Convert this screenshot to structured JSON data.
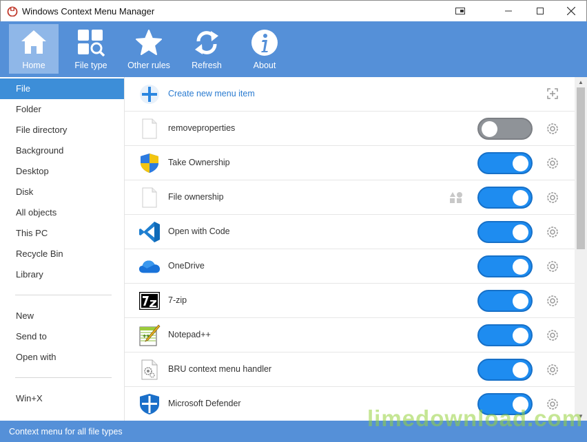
{
  "window": {
    "title": "Windows Context Menu Manager",
    "controls": [
      "restore-window-icon",
      "minimize-icon",
      "maximize-icon",
      "close-icon"
    ]
  },
  "ribbon": {
    "buttons": [
      {
        "label": "Home",
        "icon": "home-icon",
        "active": true
      },
      {
        "label": "File type",
        "icon": "file-type-icon",
        "active": false
      },
      {
        "label": "Other rules",
        "icon": "star-icon",
        "active": false
      },
      {
        "label": "Refresh",
        "icon": "refresh-icon",
        "active": false
      },
      {
        "label": "About",
        "icon": "info-icon",
        "active": false
      }
    ]
  },
  "sidebar": {
    "items": [
      {
        "label": "File",
        "active": true
      },
      {
        "label": "Folder"
      },
      {
        "label": "File directory"
      },
      {
        "label": "Background"
      },
      {
        "label": "Desktop"
      },
      {
        "label": "Disk"
      },
      {
        "label": "All objects"
      },
      {
        "label": "This PC"
      },
      {
        "label": "Recycle Bin"
      },
      {
        "label": "Library"
      },
      {
        "label": "New"
      },
      {
        "label": "Send to"
      },
      {
        "label": "Open with"
      },
      {
        "label": "Win+X"
      }
    ]
  },
  "list": {
    "create_label": "Create new menu item",
    "items": [
      {
        "label": "removeproperties",
        "icon": "blank-file-icon",
        "enabled": false
      },
      {
        "label": "Take Ownership",
        "icon": "uac-shield-icon",
        "enabled": true
      },
      {
        "label": "File ownership",
        "icon": "blank-file-icon",
        "enabled": true,
        "badge": "shapes-icon"
      },
      {
        "label": "Open with Code",
        "icon": "vscode-icon",
        "enabled": true
      },
      {
        "label": "OneDrive",
        "icon": "onedrive-icon",
        "enabled": true
      },
      {
        "label": "7-zip",
        "icon": "7zip-icon",
        "enabled": true
      },
      {
        "label": "Notepad++",
        "icon": "notepadpp-icon",
        "enabled": true
      },
      {
        "label": "BRU context menu handler",
        "icon": "gear-file-icon",
        "enabled": true
      },
      {
        "label": "Microsoft Defender",
        "icon": "defender-icon",
        "enabled": true
      }
    ]
  },
  "statusbar": {
    "text": "Context menu for all file types"
  },
  "watermark": "limedownload.com",
  "colors": {
    "ribbon": "#5590d8",
    "accent": "#3d8ed8",
    "toggle_on": "#1e8cf0",
    "toggle_off": "#8f9398"
  }
}
